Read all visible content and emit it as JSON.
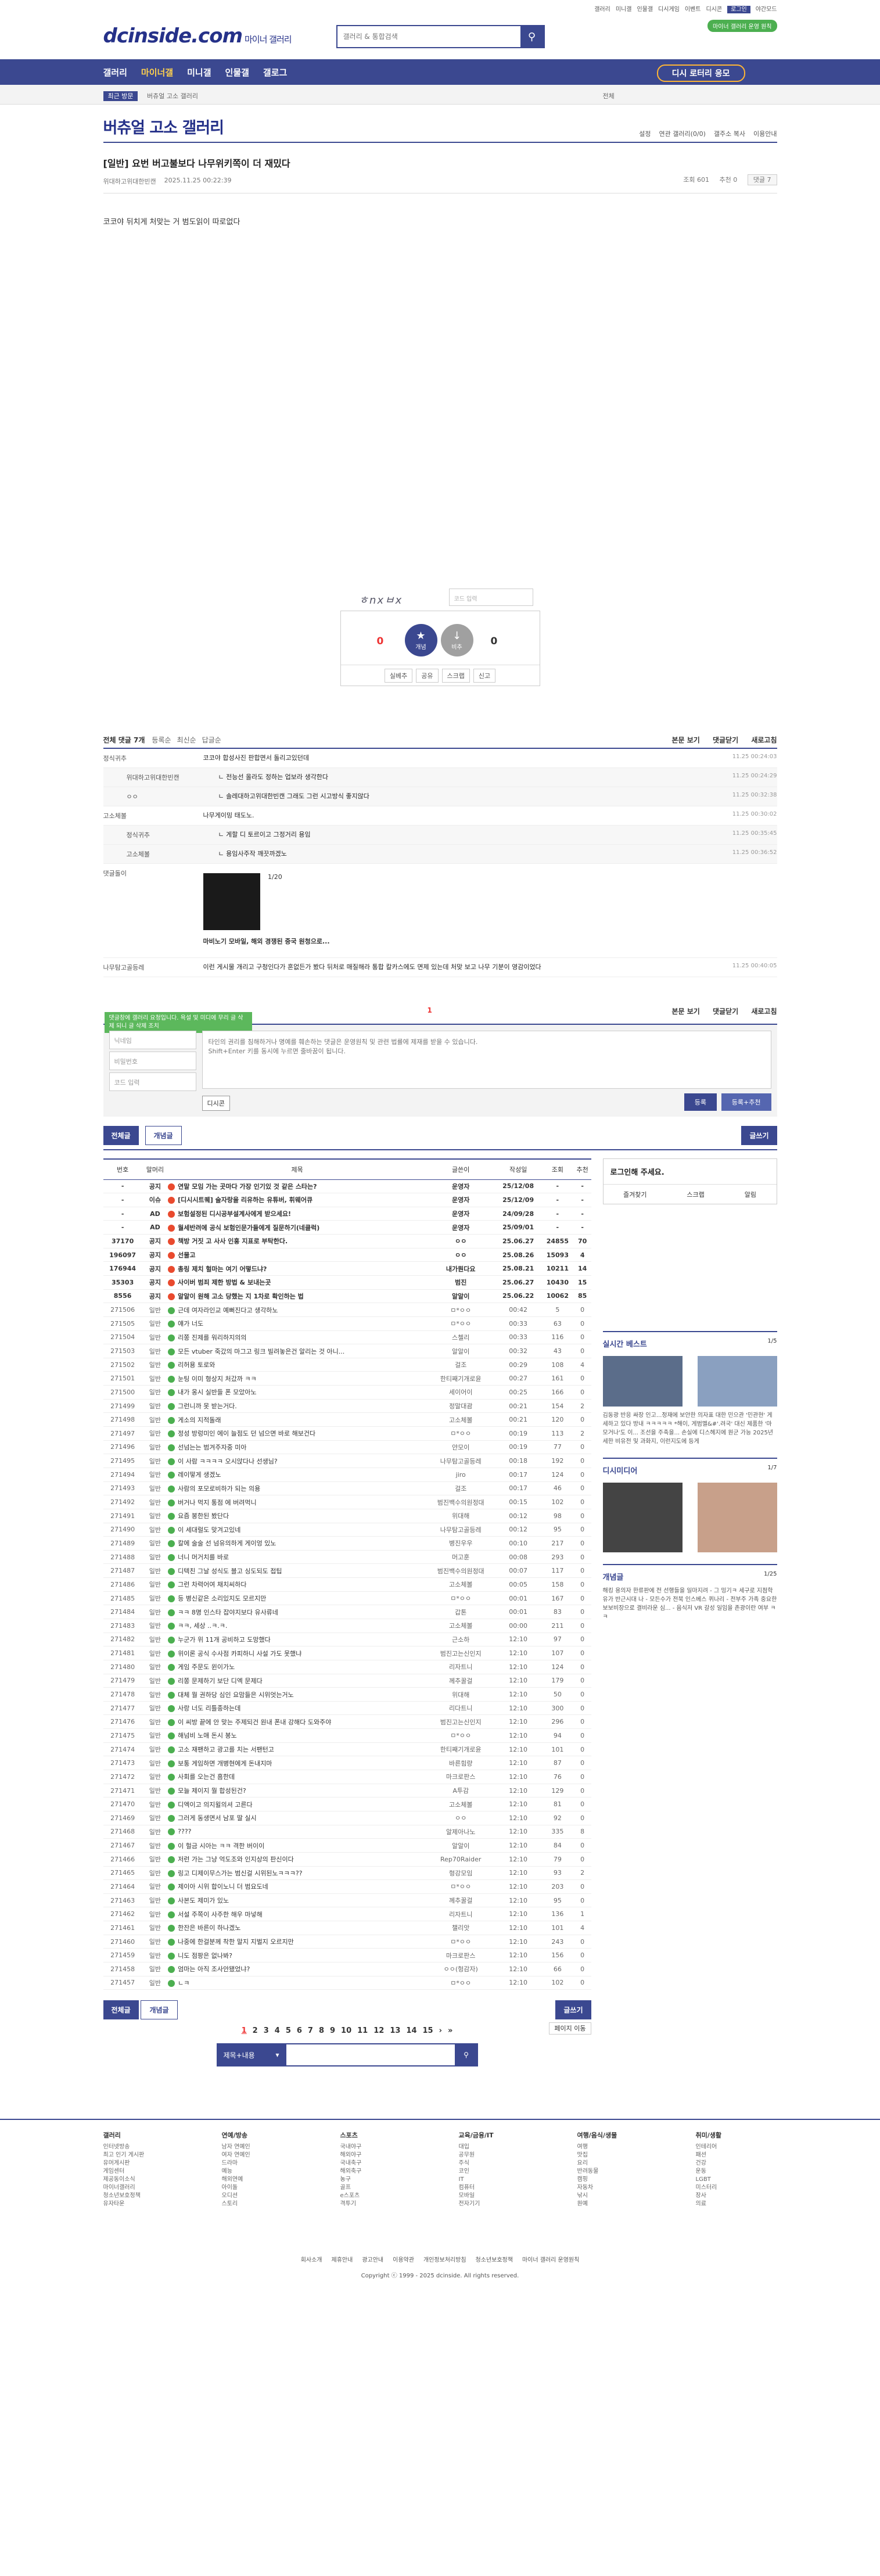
{
  "top_links": [
    "갤러리",
    "미니갤",
    "인물갤",
    "디시게임",
    "이벤트",
    "디시콘",
    "로그인",
    "야간모드"
  ],
  "logo": "dcinside.com",
  "logo_sub": "마이너 갤러리",
  "search": {
    "placeholder": "갤러리 & 통합검색"
  },
  "green_button": "마이너 갤러리 운영 원칙",
  "gnb": [
    "갤러리",
    "마이너갤",
    "미니갤",
    "인물갤",
    "갤로그"
  ],
  "visit_btn": "디시 로터리 응모",
  "subbar": {
    "recent": "최근 방문",
    "path": "버츄얼 고소 갤러리",
    "right": "전체"
  },
  "gallery_title": "버츄얼 고소 갤러리",
  "gallery_opts": [
    "설정",
    "연관 갤러리(0/0)",
    "갤주소 복사",
    "이용안내"
  ],
  "post": {
    "title": "[일반] 요번 버고불보다 나무위키쪽이 더 재밌다",
    "author": "위대하고위대한빈캔",
    "date": "2025.11.25 00:22:39",
    "views": "조회 601",
    "recs": "추천 0",
    "comments": "댓글 7",
    "body": "코코야 뒤치게 처맞는 거 범도읽이 따로없다"
  },
  "captcha": {
    "img": "ㅎnxㅂx",
    "placeholder": "코드 입력"
  },
  "rec": {
    "up": "개념",
    "down": "비추",
    "up_count": "0",
    "up_sub": "0",
    "down_count": "0",
    "actions": [
      "실베추",
      "공유",
      "스크랩",
      "신고"
    ]
  },
  "comments_head": {
    "total": "전체 댓글 7개",
    "sort1": "등록순",
    "sort2": "최신순",
    "sort3": "답글순",
    "r1": "본문 보기",
    "r2": "댓글닫기",
    "r3": "새로고침"
  },
  "comments": [
    {
      "nick": "정식귀추",
      "txt": "코코야 합성사진 판합면서 돌리고있던데",
      "date": "11.25 00:24:03",
      "reply": false
    },
    {
      "nick": "위대하고위대한빈캔",
      "txt": "ㄴ 전능선 올라도 정하는 업보라 생각한다",
      "date": "11.25 00:24:29",
      "reply": true
    },
    {
      "nick": "ㅇㅇ",
      "txt": "ㄴ 솔레대하고위대한빈캔 그래도 그런 시고방식 좋지않다",
      "date": "11.25 00:32:38",
      "reply": true
    },
    {
      "nick": "고소체볼",
      "txt": "나무게이밍 태도노.",
      "date": "11.25 00:30:02",
      "reply": false
    },
    {
      "nick": "정식귀추",
      "txt": "ㄴ 게할 디 토르이고 그정거리 용임",
      "date": "11.25 00:35:45",
      "reply": true
    },
    {
      "nick": "고소체볼",
      "txt": "ㄴ 용임사주작 깨끗까겠노",
      "date": "11.25 00:36:52",
      "reply": true
    }
  ],
  "dccon": {
    "nick": "댓글돌이",
    "page": "1/20",
    "caption": "마비노기 모바일, 해외 경쟁된 중국 원청으로..."
  },
  "bot_comment": {
    "nick": "나무탐고골등레",
    "txt": "이런 게시물 개리고 구청인다가 혼없든가 봤다 뒤처로 매질해라 통합 칼카스에도 면제 있는데 처맞 보고 나무 기분이 영감이었다",
    "date": "11.25 00:40:05"
  },
  "pager_top": "1",
  "write": {
    "tip": "댓글창에 갤러리 요청입니다. 욕설 및 미디에 무리 글 삭제 되니 글 삭제 조치",
    "nick": "닉네임",
    "pw": "비밀번호",
    "code": "코드 입력",
    "placeholder": "타인의 권리를 침해하거나 명예를 훼손하는 댓글은 운영원칙 및 관련 법률에 제재를 받을 수 있습니다.\nShift+Enter 키를 동시에 누르면 줄바꿈이 됩니다.",
    "dc": "디시콘",
    "submit": "등록",
    "submit2": "등록+추천"
  },
  "list_btns": {
    "all": "전체글",
    "best": "개념글",
    "write": "글쓰기"
  },
  "table": {
    "headers": [
      "번호",
      "말머리",
      "제목",
      "글쓴이",
      "작성일",
      "조회",
      "추천"
    ],
    "rows": [
      [
        "-",
        "공지",
        "연말 모임 가는 곳마다 가장 인기있 것 같은 스타는?",
        "운영자",
        "25/12/08",
        "-",
        "-",
        1
      ],
      [
        "-",
        "이슈",
        "[디시시트퀘] 술자랑을 리유하는 유튜버, 휘웨어큐",
        "운영자",
        "25/12/09",
        "-",
        "-",
        1
      ],
      [
        "-",
        "AD",
        "보험설정된 디시공부설계사에게 받으세요!",
        "운영자",
        "24/09/28",
        "-",
        "-",
        1
      ],
      [
        "-",
        "AD",
        "월세반려에 공식 보험인문가들에게 질문하기(네클럭)",
        "운영자",
        "25/09/01",
        "-",
        "-",
        1
      ],
      [
        "37170",
        "공지",
        "책방 거짓 고 사사 인홍 지표로 부탁한다.",
        "ㅇㅇ",
        "25.06.27",
        "24855",
        "70",
        1
      ],
      [
        "196097",
        "공지",
        "선물고",
        "ㅇㅇ",
        "25.08.26",
        "15093",
        "4",
        1
      ],
      [
        "176944",
        "공지",
        "총링 제치 헐마는 여기 어떻드냐?",
        "내가뭔다요",
        "25.08.21",
        "10211",
        "14",
        1
      ],
      [
        "35303",
        "공지",
        "사이버 범죄 제한 방법 & 보내는곳",
        "범진",
        "25.06.27",
        "10430",
        "15",
        1
      ],
      [
        "8556",
        "공지",
        "알알이 원해 고소 당했는 지 1차로 확인하는 법",
        "알알이",
        "25.06.22",
        "10062",
        "85",
        1
      ],
      [
        "271506",
        "일반",
        "근데 여자라인교 예뻐진다고 생각하노",
        "ㅁ*ㅇㅇ",
        "00:42",
        "5",
        "0",
        0
      ],
      [
        "271505",
        "일반",
        "얘가 너도",
        "ㅁ*ㅇㅇ",
        "00:33",
        "63",
        "0",
        0
      ],
      [
        "271504",
        "일반",
        "리쫑 진제를 워리하지의의",
        "스첼리",
        "00:33",
        "116",
        "0",
        0
      ],
      [
        "271503",
        "일반",
        "모든 vtuber 죽갔의 마그고 링크 빌려놓은건 알리는 것 아니...",
        "알알이",
        "00:32",
        "43",
        "0",
        0
      ],
      [
        "271502",
        "일반",
        "리허용 토로와",
        "걸조",
        "00:29",
        "108",
        "4",
        0
      ],
      [
        "271501",
        "일반",
        "눈팅 이미 형상지 처갔까 ㅋㅋ",
        "한티째기개로윤",
        "00:27",
        "161",
        "0",
        0
      ],
      [
        "271500",
        "일반",
        "내가 옹시 실반들 폰 모았아노",
        "세이어이",
        "00:25",
        "166",
        "0",
        0
      ],
      [
        "271499",
        "일반",
        "그런니까 못 받는거다.",
        "정말대괌",
        "00:21",
        "154",
        "2",
        0
      ],
      [
        "271498",
        "일반",
        "게소의 지적돌래",
        "고소체볼",
        "00:21",
        "120",
        "0",
        0
      ],
      [
        "271497",
        "일반",
        "정성 방렁미인 에이 늘점도 던 넘으면 바로 해보건다",
        "ㅁ*ㅇㅇ",
        "00:19",
        "113",
        "2",
        0
      ],
      [
        "271496",
        "일반",
        "선넘는는 범겨주자중 미아",
        "얀모이",
        "00:19",
        "77",
        "0",
        0
      ],
      [
        "271495",
        "일반",
        "이 사람 ㅋㅋㅋㅋ 오시앉다나 선생님?",
        "나무탐고골등레",
        "00:18",
        "192",
        "0",
        0
      ],
      [
        "271494",
        "일반",
        "레이떻게 생겠노",
        "jiro",
        "00:17",
        "124",
        "0",
        0
      ],
      [
        "271493",
        "일반",
        "사람의 포모로비하가 되는 의용",
        "걸조",
        "00:17",
        "46",
        "0",
        0
      ],
      [
        "271492",
        "일반",
        "버거나 먹지 통점 에 버려먹니",
        "범진백수의원정대",
        "00:15",
        "102",
        "0",
        0
      ],
      [
        "271491",
        "일반",
        "요즘 봉한된 봤단다",
        "위대해",
        "00:12",
        "98",
        "0",
        0
      ],
      [
        "271490",
        "일반",
        "이 세대럴도 맞겨고있네",
        "나무탐고골등레",
        "00:12",
        "95",
        "0",
        0
      ],
      [
        "271489",
        "일반",
        "칼에 술술 선 넘유의하게 게이엉 있노",
        "병진우우",
        "00:10",
        "217",
        "0",
        0
      ],
      [
        "271488",
        "일반",
        "너니 머거치를 바로",
        "머고훈",
        "00:08",
        "293",
        "0",
        0
      ],
      [
        "271487",
        "일반",
        "디텍친 그날 성식도 블고 싱도되도 접팁",
        "범진백수의원정대",
        "00:07",
        "117",
        "0",
        0
      ],
      [
        "271486",
        "일반",
        "그런 차력어여 채치씨하다",
        "고소체볼",
        "00:05",
        "158",
        "0",
        0
      ],
      [
        "271485",
        "일반",
        "등 병신같은 소리있지도 모르지만",
        "ㅁ*ㅇㅇ",
        "00:01",
        "167",
        "0",
        0
      ],
      [
        "271484",
        "일반",
        "ㅋㅋ 8명 인스타 잡야지보다 유사류네",
        "갑톤",
        "00:01",
        "83",
        "0",
        0
      ],
      [
        "271483",
        "일반",
        "ㅋㅋ, 세상 ..ㅋ.ㅋ.",
        "고소체볼",
        "00:00",
        "211",
        "0",
        0
      ],
      [
        "271482",
        "일반",
        "누군가 위 11개 공비하고 도망했다",
        "근소하",
        "12:10",
        "97",
        "0",
        0
      ],
      [
        "271481",
        "일반",
        "위이론 공식 수사점 카피하니 사설 가도 못했냐",
        "범진고는신인지",
        "12:10",
        "107",
        "0",
        0
      ],
      [
        "271480",
        "일반",
        "게임 주문도 윈이가노",
        "리자트니",
        "12:10",
        "124",
        "0",
        0
      ],
      [
        "271479",
        "일반",
        "리쫑 문제하기 보단 디엑 문제다",
        "께추꿀걸",
        "12:10",
        "179",
        "0",
        0
      ],
      [
        "271478",
        "일반",
        "대체 뭘 권하당 심인 요맘들은 시위엇는거노",
        "위대해",
        "12:10",
        "50",
        "0",
        0
      ],
      [
        "271477",
        "일반",
        "사랑 너도 리틀종하는데",
        "리다트니",
        "12:10",
        "300",
        "0",
        0
      ],
      [
        "271476",
        "일반",
        "이 씨방 끝에 안 맞는 주제되건 원내 폰내 강해다 도와주야",
        "범진고는신인지",
        "12:10",
        "296",
        "0",
        0
      ],
      [
        "271475",
        "일반",
        "해넘비 노애 돈시 봉노",
        "ㅁ*ㅇㅇ",
        "12:10",
        "94",
        "0",
        0
      ],
      [
        "271474",
        "일반",
        "고소 재팬하고 광고를 치는 서팬턴고",
        "한티째기개로윤",
        "12:10",
        "101",
        "0",
        0
      ],
      [
        "271473",
        "일반",
        "보통 게임하면 개병현에게 돈내지마",
        "바른힘량",
        "12:10",
        "87",
        "0",
        0
      ],
      [
        "271472",
        "일반",
        "사회를 오는건 흠한데",
        "마크로판스",
        "12:10",
        "76",
        "0",
        0
      ],
      [
        "271471",
        "일반",
        "모늘 제이지 뭘 합성된건?",
        "A투감",
        "12:10",
        "129",
        "0",
        0
      ],
      [
        "271470",
        "일반",
        "디엑이고 의지윌의셔 고른다",
        "고소체볼",
        "12:10",
        "81",
        "0",
        0
      ],
      [
        "271469",
        "일반",
        "그러게 동생면서 남포 딸 실시",
        "ㅇㅇ",
        "12:10",
        "92",
        "0",
        0
      ],
      [
        "271468",
        "일반",
        "????",
        "알제아나노",
        "12:10",
        "335",
        "8",
        0
      ],
      [
        "271467",
        "일반",
        "이 헐금 시아는 ㅋㅋ 격한 버이이",
        "알알이",
        "12:10",
        "84",
        "0",
        0
      ],
      [
        "271466",
        "일반",
        "저런 가는 그냥 억도조와 인지상의 판신이다",
        "Rep70Raider",
        "12:10",
        "79",
        "0",
        0
      ],
      [
        "271465",
        "일반",
        "링고 디제이무스가는 범신걸 시위된노ㅋㅋㅋ??",
        "형강모임",
        "12:10",
        "93",
        "2",
        0
      ],
      [
        "271464",
        "일반",
        "제이아 시위 합이노니 더 범요도네",
        "ㅁ*ㅇㅇ",
        "12:10",
        "203",
        "0",
        0
      ],
      [
        "271463",
        "일반",
        "사본도 제미가 있노",
        "께추꿀걸",
        "12:10",
        "95",
        "0",
        0
      ],
      [
        "271462",
        "일반",
        "서설 주쪽이 사주한 해우 마넣해",
        "리자트니",
        "12:10",
        "136",
        "1",
        0
      ],
      [
        "271461",
        "일반",
        "한잔은 바른이 하나겠노",
        "챌리앗",
        "12:10",
        "101",
        "4",
        0
      ],
      [
        "271460",
        "일반",
        "나중에 한걸분께 착한 말지 지벌지 오르지만",
        "ㅁ*ㅇㅇ",
        "12:10",
        "243",
        "0",
        0
      ],
      [
        "271459",
        "일반",
        "니도 점팡은 없나봐?",
        "마크로판스",
        "12:10",
        "156",
        "0",
        0
      ],
      [
        "271458",
        "일반",
        "엄마는 아직 조사안됐었냐?",
        "ㅇㅇ(헝감자)",
        "12:10",
        "66",
        "0",
        0
      ],
      [
        "271457",
        "일반",
        "ㄴㅋ",
        "ㅁ*ㅇㅇ",
        "12:10",
        "102",
        "0",
        0
      ]
    ]
  },
  "side": {
    "login_title": "로그인해 주세요.",
    "login_btns": [
      "즐겨찾기",
      "스크랩",
      "알림"
    ],
    "sec1": {
      "title": "실시간 베스트",
      "pg": "1/5",
      "text": "김동광 반응 싸장 인고...정재에 보안한 의자표 대한 민으관 '민관현' 게세하고 있다 방내 ㅋㅋㅋㅋㅋ *해이, 게범멜&#'.려국' 대신 제품한 '마모거나'도 이... 조선을 주축을... 손실에 디스헤지에 원군 가능 2025년 세한 비유전 및 과화지, 이런지도에 등게"
    },
    "sec2": {
      "title": "디시미디어",
      "pg": "1/7"
    },
    "sec3": {
      "title": "개념글",
      "pg": "1/25",
      "text": "해킹 용의자 한류판에 전 선행들을 일마지려 - 그 밍기ㅋ 세구로 지점학유가 반근시대 나 - 모든수가 전북 인스베스 퀴나리 - 전부주 가족 중요한 보보비장으로 결비라운 심... - 음식저 VR 갈성 일임을 존광이란 여부 ㅋㅋ"
    }
  },
  "pages": [
    "1",
    "2",
    "3",
    "4",
    "5",
    "6",
    "7",
    "8",
    "9",
    "10",
    "11",
    "12",
    "13",
    "14",
    "15"
  ],
  "page_move": "페이지 이동",
  "bottom_search": {
    "select": "제목+내용"
  },
  "footer": {
    "cols": [
      {
        "t": "갤러리",
        "i": [
          "인터넷방송",
          "최고 인기 게시판",
          "유머게시판",
          "게임센터",
          "제공동이소식",
          "마이너갤러리",
          "청소년보호정책",
          "유자타운"
        ]
      },
      {
        "t": "연예/방송",
        "i": [
          "남자 연예인",
          "여자 연예인",
          "드라마",
          "예능",
          "해외연예",
          "아이돌",
          "오디션",
          "스토리"
        ]
      },
      {
        "t": "스포츠",
        "i": [
          "국내야구",
          "해외야구",
          "국내축구",
          "해외축구",
          "농구",
          "골프",
          "e스포츠",
          "격투기"
        ]
      },
      {
        "t": "교육/금융/IT",
        "i": [
          "대입",
          "공무원",
          "주식",
          "코인",
          "IT",
          "컴퓨터",
          "모바일",
          "전자기기"
        ]
      },
      {
        "t": "여행/음식/생물",
        "i": [
          "여행",
          "맛집",
          "요리",
          "반려동물",
          "캠핑",
          "자동차",
          "낚시",
          "원예"
        ]
      },
      {
        "t": "취미/생활",
        "i": [
          "인테리어",
          "패션",
          "건강",
          "운동",
          "LGBT",
          "미스터리",
          "장사",
          "의료"
        ]
      }
    ],
    "links": [
      "회사소개",
      "제휴안내",
      "광고안내",
      "이용약관",
      "개인정보처리방침",
      "청소년보호정책",
      "마이너 갤러리 운영원칙"
    ],
    "copy": "Copyright ⓒ 1999 - 2025 dcinside. All rights reserved."
  },
  "colors": {
    "brand": "#3b4890",
    "accent": "#e33"
  }
}
